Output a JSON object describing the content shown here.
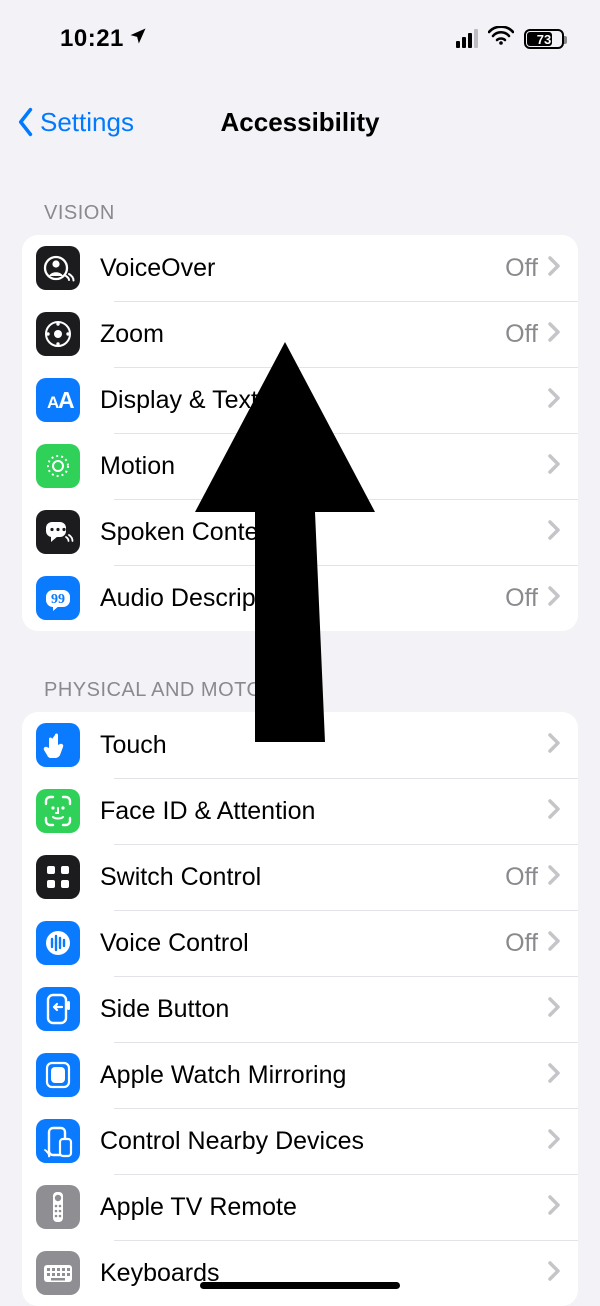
{
  "status": {
    "time": "10:21",
    "battery_pct": "73",
    "battery_fill_pct": 73
  },
  "nav": {
    "back_label": "Settings",
    "title": "Accessibility"
  },
  "sections": {
    "vision": {
      "header": "Vision",
      "rows": {
        "voiceover": {
          "label": "VoiceOver",
          "value": "Off"
        },
        "zoom": {
          "label": "Zoom",
          "value": "Off"
        },
        "display": {
          "label": "Display & Text Size",
          "value": ""
        },
        "motion": {
          "label": "Motion",
          "value": ""
        },
        "spoken": {
          "label": "Spoken Content",
          "value": ""
        },
        "audiodesc": {
          "label": "Audio Descriptions",
          "value": "Off"
        }
      }
    },
    "physical": {
      "header": "Physical and Motor",
      "rows": {
        "touch": {
          "label": "Touch",
          "value": ""
        },
        "faceid": {
          "label": "Face ID & Attention",
          "value": ""
        },
        "switch": {
          "label": "Switch Control",
          "value": "Off"
        },
        "voice": {
          "label": "Voice Control",
          "value": "Off"
        },
        "sidebutton": {
          "label": "Side Button",
          "value": ""
        },
        "watch": {
          "label": "Apple Watch Mirroring",
          "value": ""
        },
        "nearby": {
          "label": "Control Nearby Devices",
          "value": ""
        },
        "tvremote": {
          "label": "Apple TV Remote",
          "value": ""
        },
        "keyboards": {
          "label": "Keyboards",
          "value": ""
        }
      }
    }
  }
}
